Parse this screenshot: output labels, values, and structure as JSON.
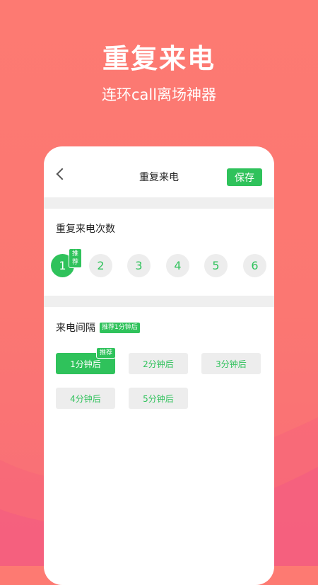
{
  "hero": {
    "title": "重复来电",
    "subtitle": "连环call离场神器"
  },
  "nav": {
    "title": "重复来电",
    "save_label": "保存"
  },
  "repeat_count": {
    "title": "重复来电次数",
    "recommend_tag": "推荐",
    "options": [
      "1",
      "2",
      "3",
      "4",
      "5",
      "6"
    ],
    "selected": "1"
  },
  "interval": {
    "title": "来电间隔",
    "recommend_badge": "推荐1分钟后",
    "recommend_tag": "推荐",
    "options": [
      "1分钟后",
      "2分钟后",
      "3分钟后",
      "4分钟后",
      "5分钟后"
    ],
    "selected": "1分钟后"
  },
  "colors": {
    "accent": "#2fc25b",
    "background": "#fd7a72",
    "chip": "#ededed"
  }
}
